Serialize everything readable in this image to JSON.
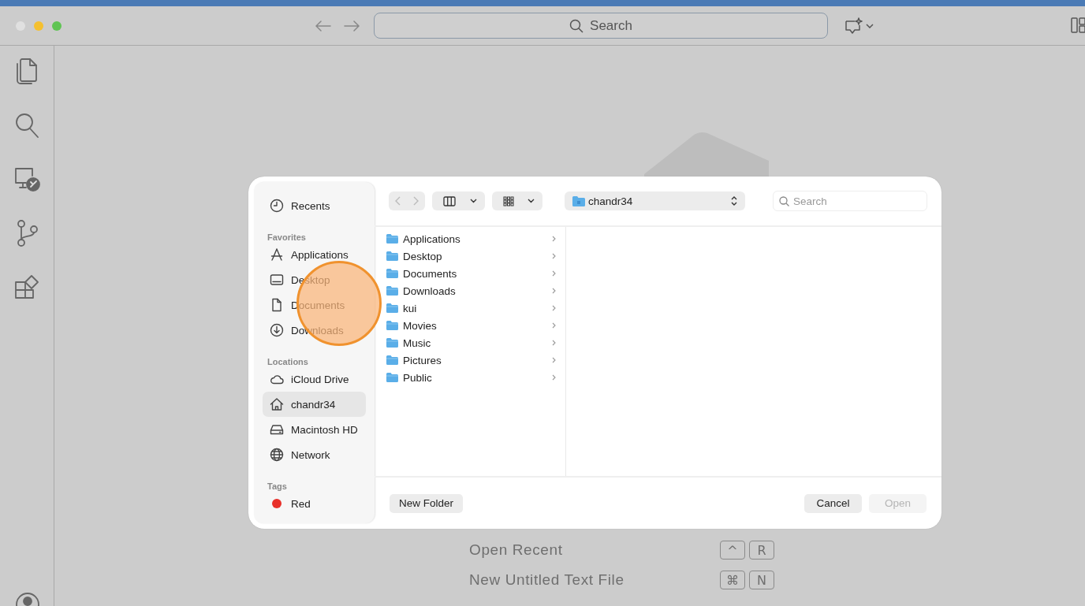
{
  "title_bar": {
    "command_center": "Search"
  },
  "dialog": {
    "sidebar": {
      "top_items": [
        {
          "label": "Recents",
          "kind": "clock",
          "selected": false
        }
      ],
      "sections": [
        {
          "heading": "Favorites",
          "items": [
            {
              "label": "Applications",
              "kind": "apps",
              "selected": false
            },
            {
              "label": "Desktop",
              "kind": "desktop",
              "selected": false
            },
            {
              "label": "Documents",
              "kind": "document",
              "selected": false
            },
            {
              "label": "Downloads",
              "kind": "download",
              "selected": false
            }
          ]
        },
        {
          "heading": "Locations",
          "items": [
            {
              "label": "iCloud Drive",
              "kind": "cloud",
              "selected": false
            },
            {
              "label": "chandr34",
              "kind": "home",
              "selected": true
            },
            {
              "label": "Macintosh HD",
              "kind": "disk",
              "selected": false
            },
            {
              "label": "Network",
              "kind": "globe",
              "selected": false
            }
          ]
        },
        {
          "heading": "Tags",
          "items": [
            {
              "label": "Red",
              "kind": "tag",
              "color": "#e8302a",
              "selected": false
            }
          ]
        }
      ]
    },
    "location": "chandr34",
    "search_placeholder": "Search",
    "files": [
      {
        "name": "Applications"
      },
      {
        "name": "Desktop"
      },
      {
        "name": "Documents"
      },
      {
        "name": "Downloads"
      },
      {
        "name": "kui"
      },
      {
        "name": "Movies"
      },
      {
        "name": "Music"
      },
      {
        "name": "Pictures"
      },
      {
        "name": "Public"
      }
    ],
    "new_folder": "New Folder",
    "cancel": "Cancel",
    "open": {
      "label": "Open",
      "disabled": true
    }
  },
  "shortcuts": [
    {
      "label": "Open Recent",
      "keys": [
        "^",
        "R"
      ]
    },
    {
      "label": "New Untitled Text File",
      "keys": [
        "⌘",
        "N"
      ]
    }
  ]
}
